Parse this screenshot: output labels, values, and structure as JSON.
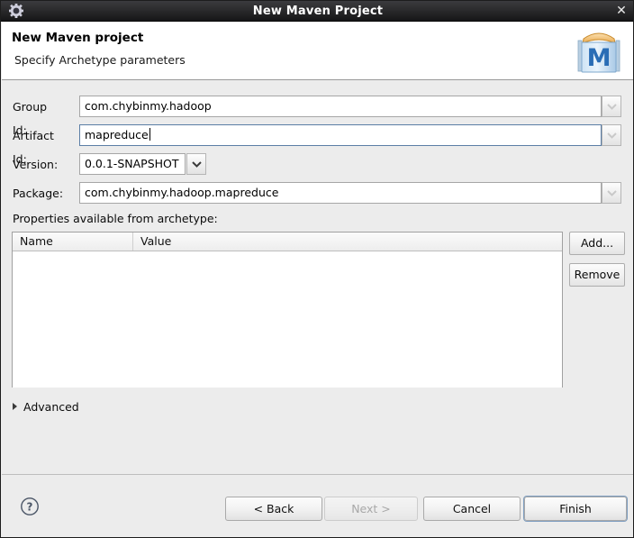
{
  "window": {
    "title": "New Maven Project",
    "icon": "gear-icon",
    "close_label": "✕"
  },
  "header": {
    "title": "New Maven project",
    "subtitle": "Specify Archetype parameters",
    "logo": "maven-logo",
    "logo_letter": "M"
  },
  "form": {
    "fields": [
      {
        "label": "Group Id:",
        "value": "com.chybinmy.hadoop",
        "type": "combo-text",
        "focused": false
      },
      {
        "label": "Artifact Id:",
        "value": "mapreduce",
        "type": "combo-text",
        "focused": true
      },
      {
        "label": "Version:",
        "value": "0.0.1-SNAPSHOT",
        "type": "combo",
        "focused": false
      },
      {
        "label": "Package:",
        "value": "com.chybinmy.hadoop.mapreduce",
        "type": "combo-text",
        "focused": false
      }
    ]
  },
  "properties": {
    "section_label": "Properties available from archetype:",
    "columns": [
      "Name",
      "Value"
    ],
    "rows": [],
    "add_label": "Add...",
    "remove_label": "Remove"
  },
  "advanced": {
    "label": "Advanced",
    "expanded": false,
    "icon": "triangle-right-icon"
  },
  "footer": {
    "help_icon": "help-circle-icon",
    "buttons": [
      {
        "label": "< Back",
        "disabled": false,
        "default": false
      },
      {
        "label": "Next >",
        "disabled": true,
        "default": false
      },
      {
        "label": "Cancel",
        "disabled": false,
        "default": false
      },
      {
        "label": "Finish",
        "disabled": false,
        "default": true
      }
    ]
  },
  "colors": {
    "titlebar": "#2b2b2d",
    "dialog_bg": "#ececec",
    "field_bg": "#ffffff",
    "focus_border": "#5b7ea6",
    "default_button_ring": "#7d9dc0",
    "maven_blue": "#2a6db5",
    "maven_lid": "#f0b96a"
  }
}
